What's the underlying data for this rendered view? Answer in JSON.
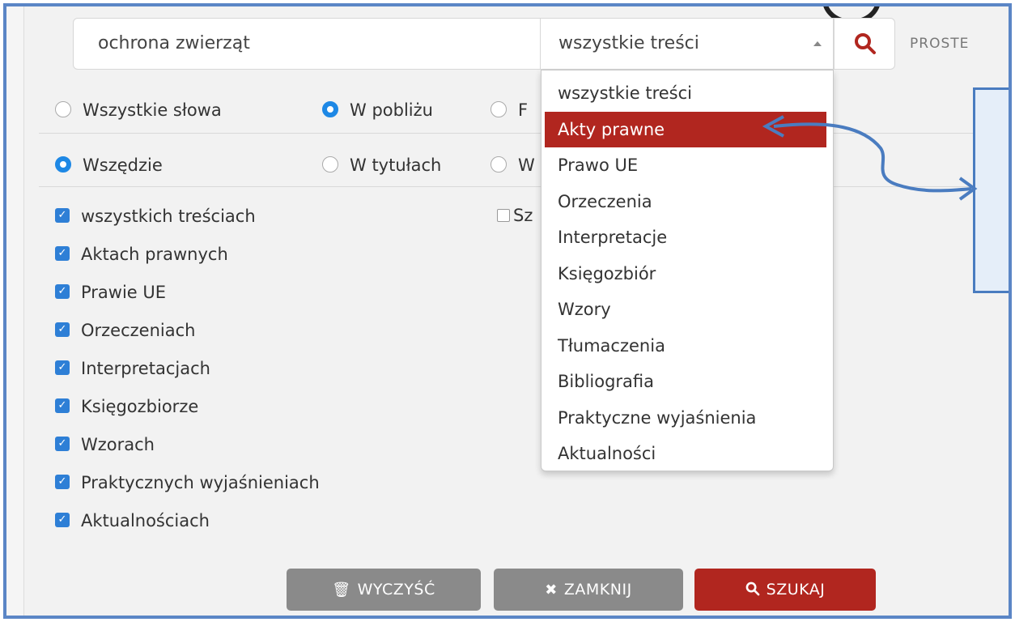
{
  "search": {
    "query": "ochrona zwierząt",
    "scope_selected": "wszystkie treści",
    "mode_label": "PROSTE"
  },
  "match_options": [
    {
      "label": "Wszystkie słowa",
      "selected": false
    },
    {
      "label": "W pobliżu",
      "selected": true
    },
    {
      "label": "F",
      "selected": false
    }
  ],
  "location_options": [
    {
      "label": "Wszędzie",
      "selected": true
    },
    {
      "label": "W tytułach",
      "selected": false
    },
    {
      "label": "W",
      "selected": false
    }
  ],
  "checkboxes": [
    "wszystkich treściach",
    "Aktach prawnych",
    "Prawie UE",
    "Orzeczeniach",
    "Interpretacjach",
    "Księgozbiorze",
    "Wzorach",
    "Praktycznych wyjaśnieniach",
    "Aktualnościach"
  ],
  "unchecked_option": "Sz",
  "dropdown": {
    "items": [
      "wszystkie treści",
      "Akty prawne",
      "Prawo UE",
      "Orzeczenia",
      "Interpretacje",
      "Księgozbiór",
      "Wzory",
      "Tłumaczenia",
      "Bibliografia",
      "Praktyczne wyjaśnienia",
      "Aktualności"
    ],
    "highlighted": "Akty prawne"
  },
  "buttons": {
    "clear": "WYCZYŚĆ",
    "close": "ZAMKNIJ",
    "search": "SZUKAJ"
  },
  "colors": {
    "accent_red": "#b1261f",
    "radio_blue": "#1e88e5",
    "callout_border": "#4a7cc0",
    "frame_border": "#5b86c6"
  },
  "icons": {
    "search": "magnifier-icon",
    "clear": "trash-icon",
    "close": "close-x-icon"
  }
}
